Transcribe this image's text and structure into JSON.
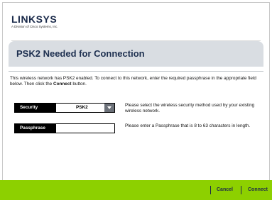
{
  "brand": {
    "name": "LINKSYS",
    "tagline": "A Division of Cisco Systems, Inc."
  },
  "title": "PSK2 Needed for Connection",
  "intro": {
    "part1": "This wireless network has PSK2 enabled. To connect to this network, enter the required passphrase in the appropriate field below. Then click the ",
    "bold": "Connect",
    "part2": " button."
  },
  "security": {
    "label": "Security",
    "value": "PSK2",
    "help": "Please select the wireless security method used by your existing wireless network."
  },
  "passphrase": {
    "label": "Passphrase",
    "value": "",
    "help": "Please enter a Passphrase that is 8 to 63 characters in length."
  },
  "footer": {
    "cancel": "Cancel",
    "connect": "Connect"
  },
  "colors": {
    "accent_green": "#8dd000",
    "title_bar": "#d9dde2",
    "navy": "#1e3050"
  }
}
